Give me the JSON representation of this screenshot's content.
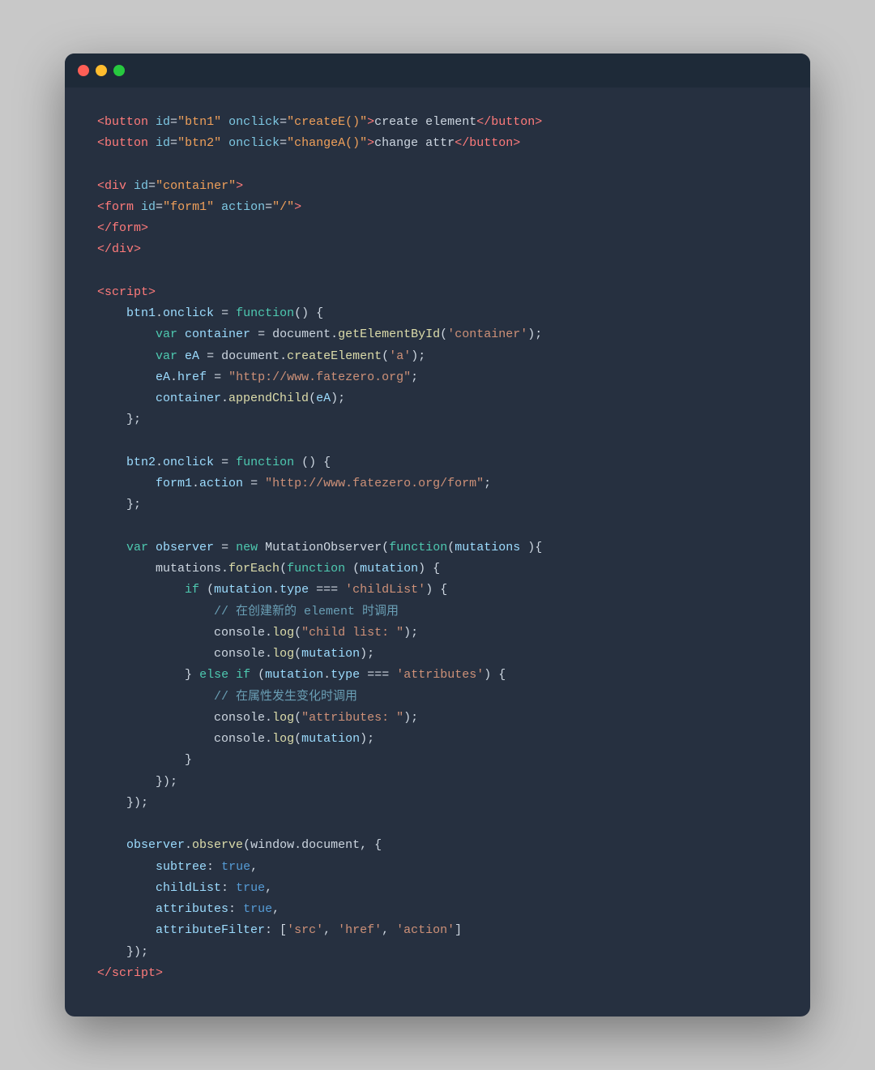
{
  "window": {
    "traffic_lights": [
      "close",
      "minimize",
      "maximize"
    ]
  },
  "code": {
    "lines": []
  }
}
